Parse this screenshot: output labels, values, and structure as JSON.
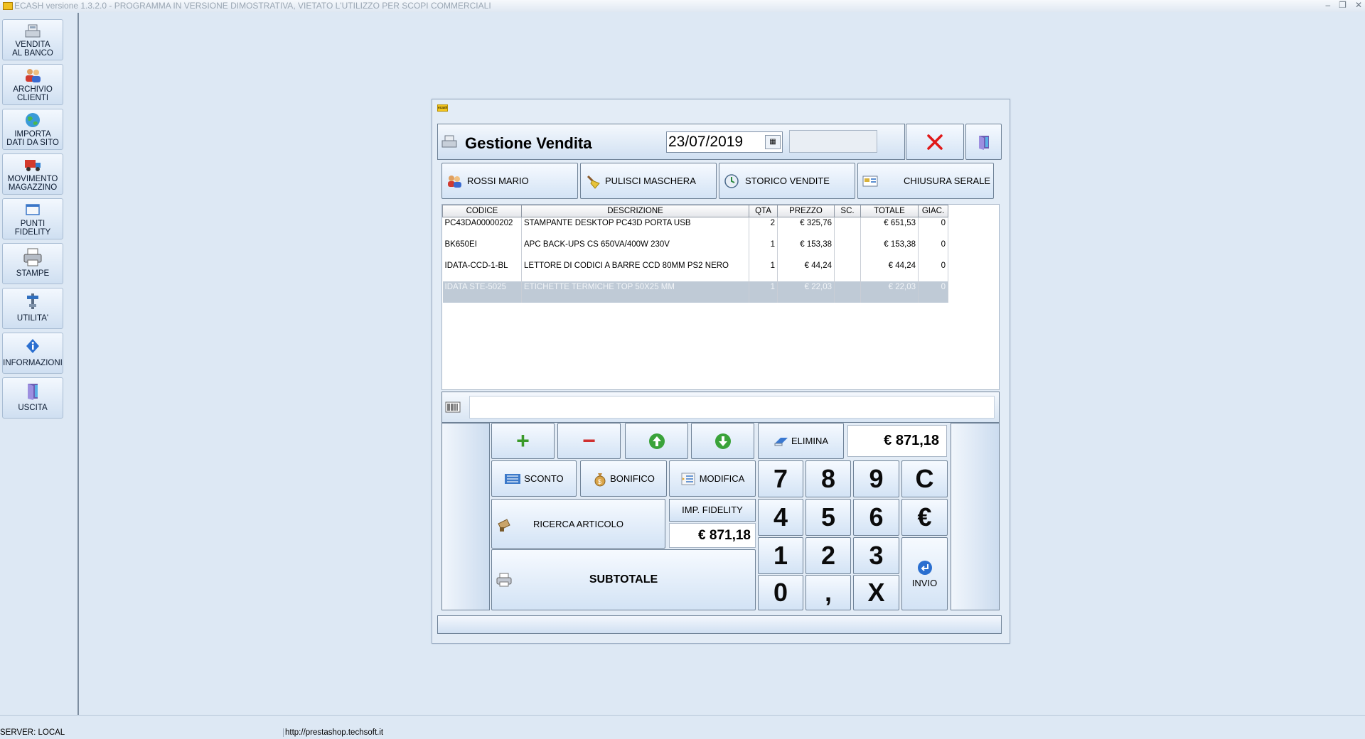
{
  "app": {
    "title": "ECASH versione 1.3.2.0 - PROGRAMMA IN VERSIONE DIMOSTRATIVA, VIETATO L'UTILIZZO PER SCOPI COMMERCIALI",
    "window_controls": [
      "–",
      "❐",
      "✕"
    ]
  },
  "sidebar": {
    "items": [
      {
        "line1": "VENDITA",
        "line2": "AL BANCO",
        "icon": "register-icon"
      },
      {
        "line1": "ARCHIVIO",
        "line2": "CLIENTI",
        "icon": "customers-icon"
      },
      {
        "line1": "IMPORTA",
        "line2": "DATI DA SITO",
        "icon": "globe-icon"
      },
      {
        "line1": "MOVIMENTO",
        "line2": "MAGAZZINO",
        "icon": "truck-icon"
      },
      {
        "line1": "PUNTI",
        "line2": "FIDELITY",
        "icon": "card-icon"
      },
      {
        "line1": "STAMPE",
        "line2": "",
        "icon": "printer-icon"
      },
      {
        "line1": "UTILITA'",
        "line2": "",
        "icon": "tools-icon"
      },
      {
        "line1": "INFORMAZIONI",
        "line2": "",
        "icon": "info-icon"
      },
      {
        "line1": "USCITA",
        "line2": "",
        "icon": "exit-door-icon"
      }
    ]
  },
  "dialog": {
    "logo_text": "ecash",
    "title": "Gestione Vendita",
    "date": "23/07/2019",
    "search_value": "",
    "actions": {
      "customer": "ROSSI MARIO",
      "clear": "PULISCI MASCHERA",
      "history": "STORICO VENDITE",
      "closing": "CHIUSURA SERALE"
    },
    "table": {
      "headers": [
        "CODICE",
        "DESCRIZIONE",
        "QTA",
        "PREZZO",
        "SC.",
        "TOTALE",
        "GIAC."
      ],
      "rows": [
        {
          "code": "PC43DA00000202",
          "desc": "STAMPANTE DESKTOP PC43D PORTA USB",
          "qty": "2",
          "price": "€ 325,76",
          "disc": "",
          "total": "€ 651,53",
          "stock": "0"
        },
        {
          "code": "BK650EI",
          "desc": "APC BACK-UPS CS 650VA/400W 230V",
          "qty": "1",
          "price": "€ 153,38",
          "disc": "",
          "total": "€ 153,38",
          "stock": "0"
        },
        {
          "code": "IDATA-CCD-1-BL",
          "desc": "LETTORE DI CODICI A BARRE CCD 80MM PS2 NERO",
          "qty": "1",
          "price": "€ 44,24",
          "disc": "",
          "total": "€ 44,24",
          "stock": "0"
        },
        {
          "code": "IDATA STE-5025",
          "desc": "ETICHETTE TERMICHE TOP 50X25 MM",
          "qty": "1",
          "price": "€ 22,03",
          "disc": "",
          "total": "€ 22,03",
          "stock": "0"
        }
      ]
    },
    "barcode_value": "",
    "pad": {
      "plus": "+",
      "minus": "−",
      "elimina": "ELIMINA",
      "total": "€ 871,18",
      "sconto": "SCONTO",
      "bonifico": "BONIFICO",
      "modifica": "MODIFICA",
      "ricerca": "RICERCA ARTICOLO",
      "imp_fidelity_label": "IMP. FIDELITY",
      "imp_fidelity_value": "€ 871,18",
      "subtotale": "SUBTOTALE",
      "invio": "INVIO",
      "keys": [
        "7",
        "8",
        "9",
        "C",
        "4",
        "5",
        "6",
        "€",
        "1",
        "2",
        "3",
        "0",
        ",",
        "X"
      ]
    }
  },
  "status": {
    "server": "SERVER: LOCAL",
    "url": "http://prestashop.techsoft.it"
  }
}
